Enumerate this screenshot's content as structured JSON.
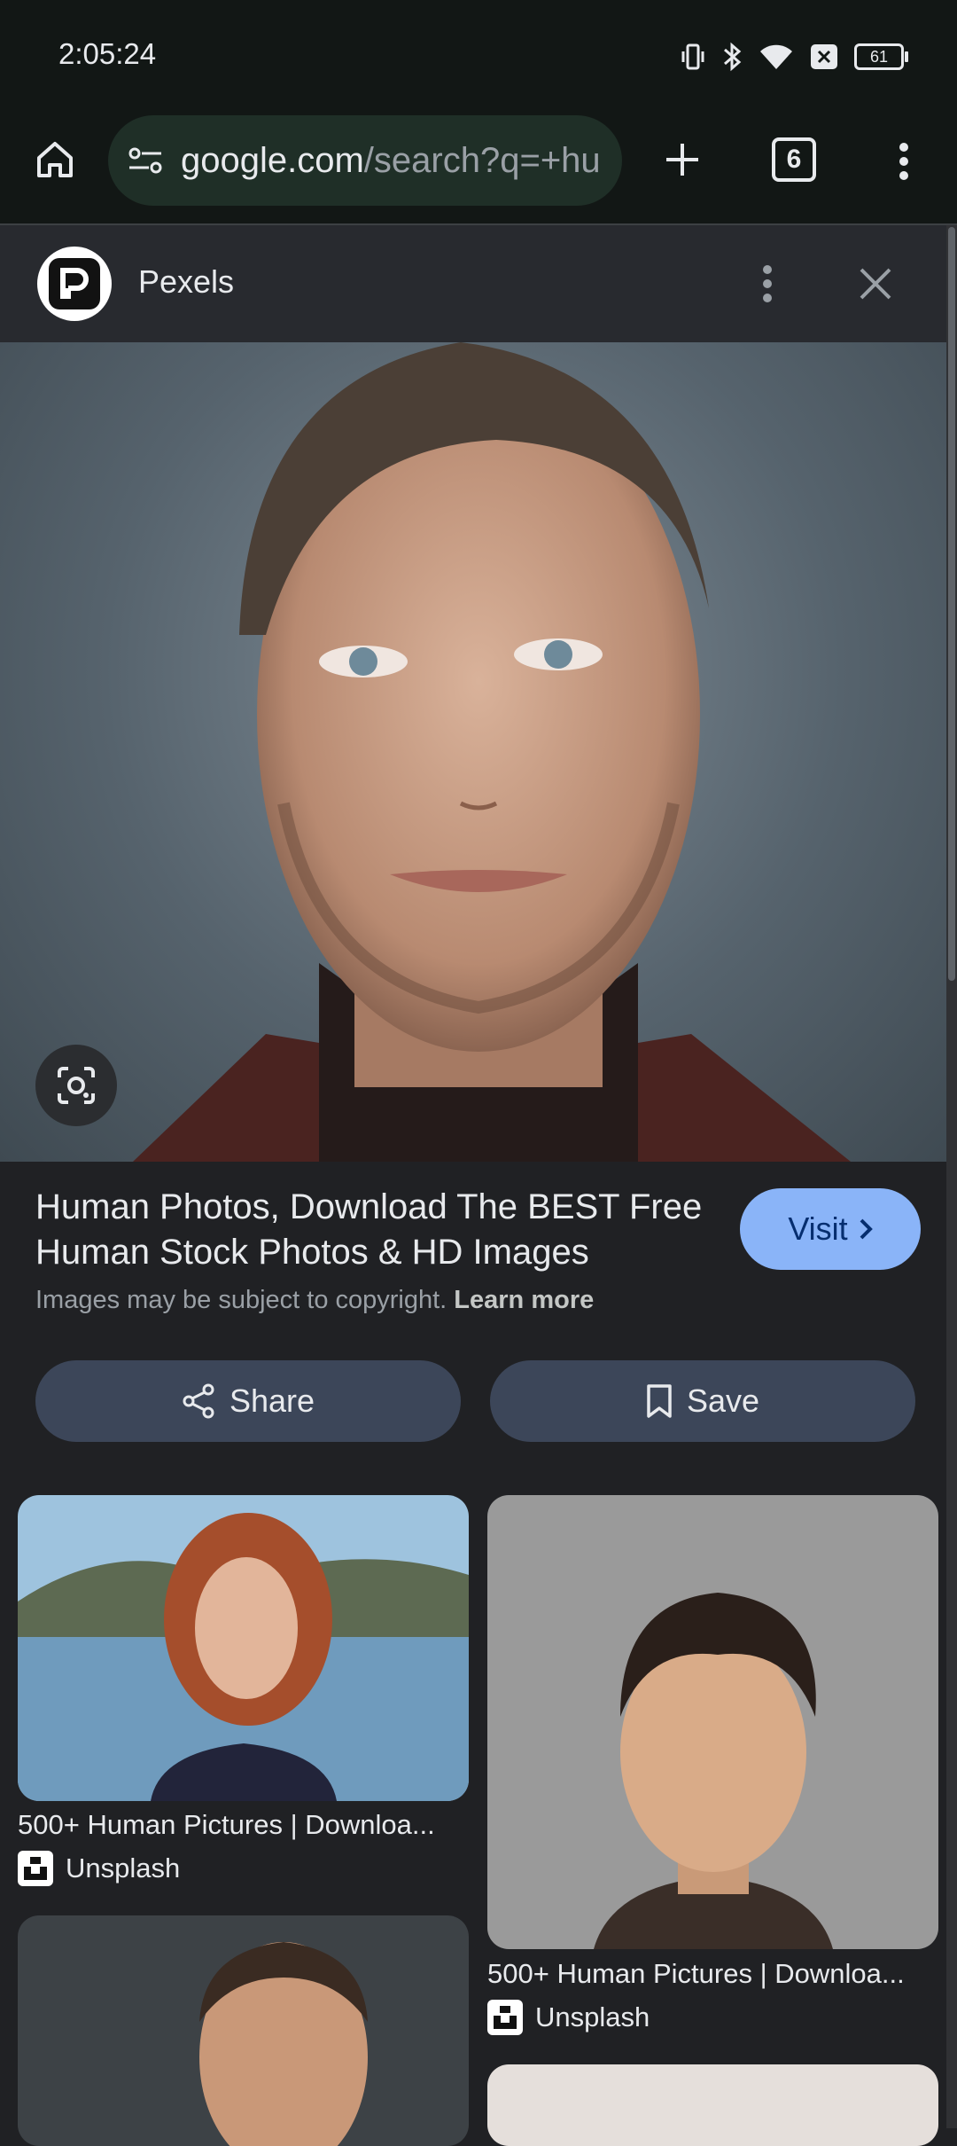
{
  "status_bar": {
    "time": "2:05:24",
    "battery": "61"
  },
  "toolbar": {
    "url_main": "google.com",
    "url_rest": "/search?q=+hu",
    "tab_count": "6"
  },
  "source": {
    "name": "Pexels"
  },
  "result": {
    "title": "Human Photos, Download The BEST Free Human Stock Photos & HD Images",
    "copyright_text": "Images may be subject to copyright.",
    "learn_more": "Learn more",
    "visit_label": "Visit",
    "share_label": "Share",
    "save_label": "Save"
  },
  "related": [
    {
      "title": "500+ Human Pictures | Downloa...",
      "source": "Unsplash"
    },
    {
      "title": "500+ Human Pictures | Downloa...",
      "source": "Unsplash"
    }
  ],
  "colors": {
    "background": "#202124",
    "toolbar": "#121715",
    "accent": "#8ab4f8",
    "action_button": "#3c4659"
  },
  "icons": [
    "vibrate-icon",
    "bluetooth-icon",
    "wifi-icon",
    "notification-x-icon",
    "battery-icon",
    "home-icon",
    "tune-icon",
    "plus-icon",
    "tab-switcher-icon",
    "more-vert-icon",
    "close-icon",
    "lens-icon",
    "chevron-right-icon",
    "share-icon",
    "bookmark-icon"
  ]
}
